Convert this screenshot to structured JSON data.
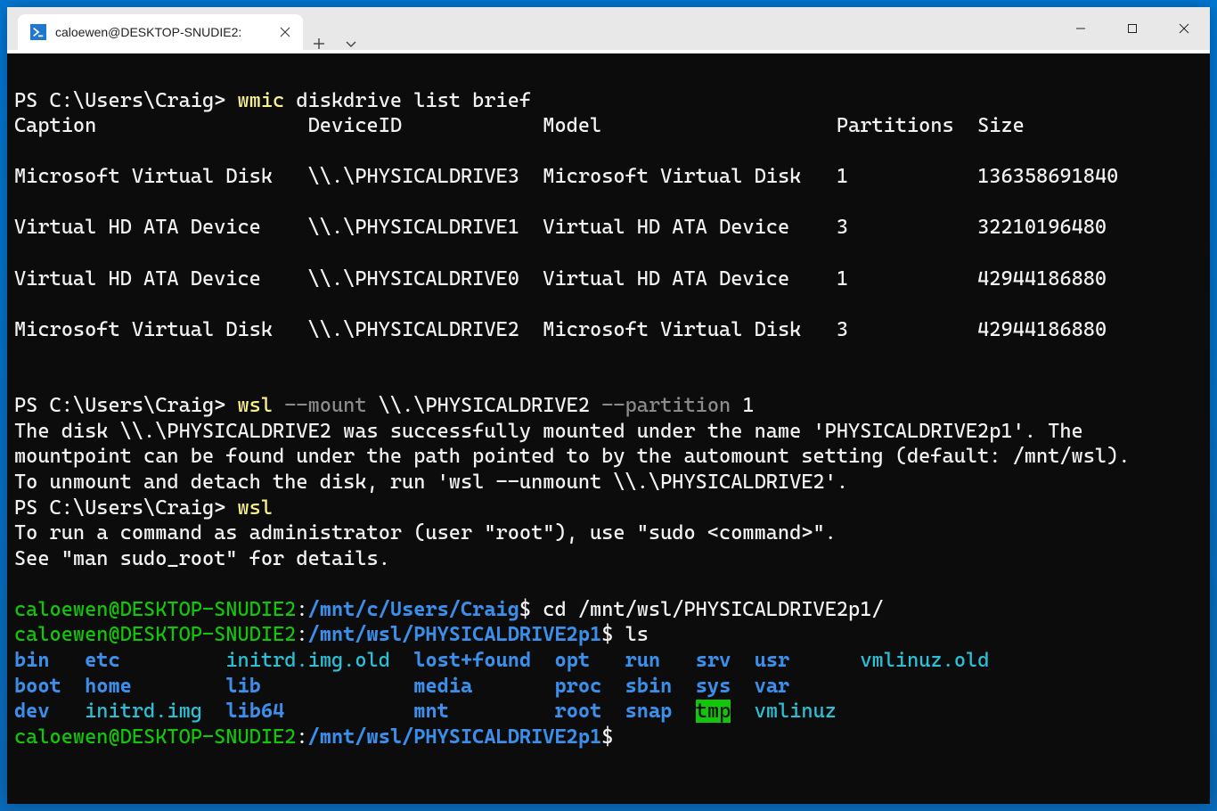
{
  "tab": {
    "title": "caloewen@DESKTOP-SNUDIE2:"
  },
  "prompt1": {
    "prefix": "PS C:\\Users\\Craig> ",
    "cmd": "wmic",
    "args": " diskdrive list brief"
  },
  "headers": {
    "caption": "Caption",
    "deviceid": "DeviceID",
    "model": "Model",
    "partitions": "Partitions",
    "size": "Size"
  },
  "drives": [
    {
      "caption": "Microsoft Virtual Disk",
      "deviceid": "\\\\.\\PHYSICALDRIVE3",
      "model": "Microsoft Virtual Disk",
      "partitions": "1",
      "size": "136358691840"
    },
    {
      "caption": "Virtual HD ATA Device",
      "deviceid": "\\\\.\\PHYSICALDRIVE1",
      "model": "Virtual HD ATA Device",
      "partitions": "3",
      "size": "32210196480"
    },
    {
      "caption": "Virtual HD ATA Device",
      "deviceid": "\\\\.\\PHYSICALDRIVE0",
      "model": "Virtual HD ATA Device",
      "partitions": "1",
      "size": "42944186880"
    },
    {
      "caption": "Microsoft Virtual Disk",
      "deviceid": "\\\\.\\PHYSICALDRIVE2",
      "model": "Microsoft Virtual Disk",
      "partitions": "3",
      "size": "42944186880"
    }
  ],
  "prompt2": {
    "prefix": "PS C:\\Users\\Craig> ",
    "cmd": "wsl",
    "opt1": " --mount",
    "arg1": " \\\\.\\PHYSICALDRIVE2",
    "opt2": " --partition",
    "arg2": " 1"
  },
  "mount_output": "The disk \\\\.\\PHYSICALDRIVE2 was successfully mounted under the name 'PHYSICALDRIVE2p1'. The mountpoint can be found under the path pointed to by the automount setting (default: /mnt/wsl).\nTo unmount and detach the disk, run 'wsl --unmount \\\\.\\PHYSICALDRIVE2'.",
  "prompt3": {
    "prefix": "PS C:\\Users\\Craig> ",
    "cmd": "wsl"
  },
  "sudo_msg": "To run a command as administrator (user \"root\"), use \"sudo <command>\".\nSee \"man sudo_root\" for details.",
  "linux1": {
    "user": "caloewen@DESKTOP-SNUDIE2",
    "colon": ":",
    "path": "/mnt/c/Users/Craig",
    "dollar": "$ ",
    "cmd": "cd /mnt/wsl/PHYSICALDRIVE2p1/"
  },
  "linux2": {
    "user": "caloewen@DESKTOP-SNUDIE2",
    "colon": ":",
    "path": "/mnt/wsl/PHYSICALDRIVE2p1",
    "dollar": "$ ",
    "cmd": "ls"
  },
  "ls": {
    "bin": "bin",
    "etc": "etc",
    "initrd_old": "initrd.img.old",
    "lostfound": "lost+found",
    "opt": "opt",
    "run": "run",
    "srv": "srv",
    "usr": "usr",
    "vmlinuz_old": "vmlinuz.old",
    "boot": "boot",
    "home": "home",
    "lib": "lib",
    "media": "media",
    "proc": "proc",
    "sbin": "sbin",
    "sys": "sys",
    "var": "var",
    "dev": "dev",
    "initrd": "initrd.img",
    "lib64": "lib64",
    "mnt": "mnt",
    "root": "root",
    "snap": "snap",
    "tmp": "tmp",
    "vmlinuz": "vmlinuz"
  },
  "linux3": {
    "user": "caloewen@DESKTOP-SNUDIE2",
    "colon": ":",
    "path": "/mnt/wsl/PHYSICALDRIVE2p1",
    "dollar": "$"
  }
}
